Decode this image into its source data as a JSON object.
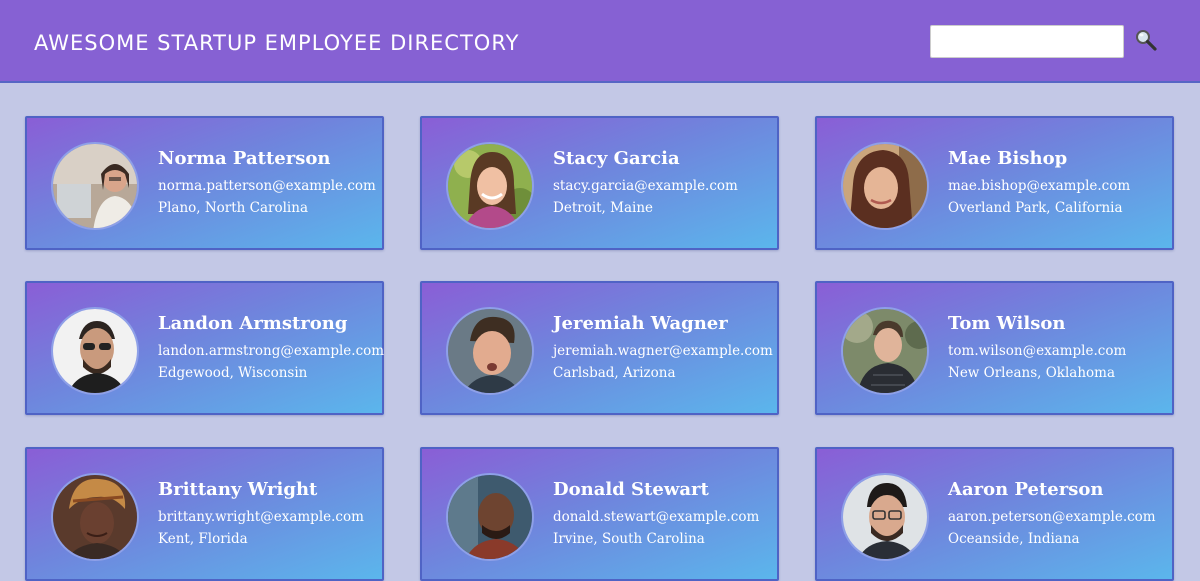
{
  "header": {
    "title": "AWESOME STARTUP EMPLOYEE DIRECTORY",
    "search_placeholder": "",
    "search_icon": "magnifier-icon"
  },
  "colors": {
    "header_bg": "#8661d3",
    "page_bg": "#c3c8e6",
    "card_gradient_start": "#8a5ed6",
    "card_gradient_end": "#5bb6ec",
    "card_border": "#4f63c5"
  },
  "employees": [
    {
      "name": "Norma Patterson",
      "email": "norma.patterson@example.com",
      "location": "Plano, North Carolina"
    },
    {
      "name": "Stacy Garcia",
      "email": "stacy.garcia@example.com",
      "location": "Detroit, Maine"
    },
    {
      "name": "Mae Bishop",
      "email": "mae.bishop@example.com",
      "location": "Overland Park, California"
    },
    {
      "name": "Landon Armstrong",
      "email": "landon.armstrong@example.com",
      "location": "Edgewood, Wisconsin"
    },
    {
      "name": "Jeremiah Wagner",
      "email": "jeremiah.wagner@example.com",
      "location": "Carlsbad, Arizona"
    },
    {
      "name": "Tom Wilson",
      "email": "tom.wilson@example.com",
      "location": "New Orleans, Oklahoma"
    },
    {
      "name": "Brittany Wright",
      "email": "brittany.wright@example.com",
      "location": "Kent, Florida"
    },
    {
      "name": "Donald Stewart",
      "email": "donald.stewart@example.com",
      "location": "Irvine, South Carolina"
    },
    {
      "name": "Aaron Peterson",
      "email": "aaron.peterson@example.com",
      "location": "Oceanside, Indiana"
    }
  ]
}
